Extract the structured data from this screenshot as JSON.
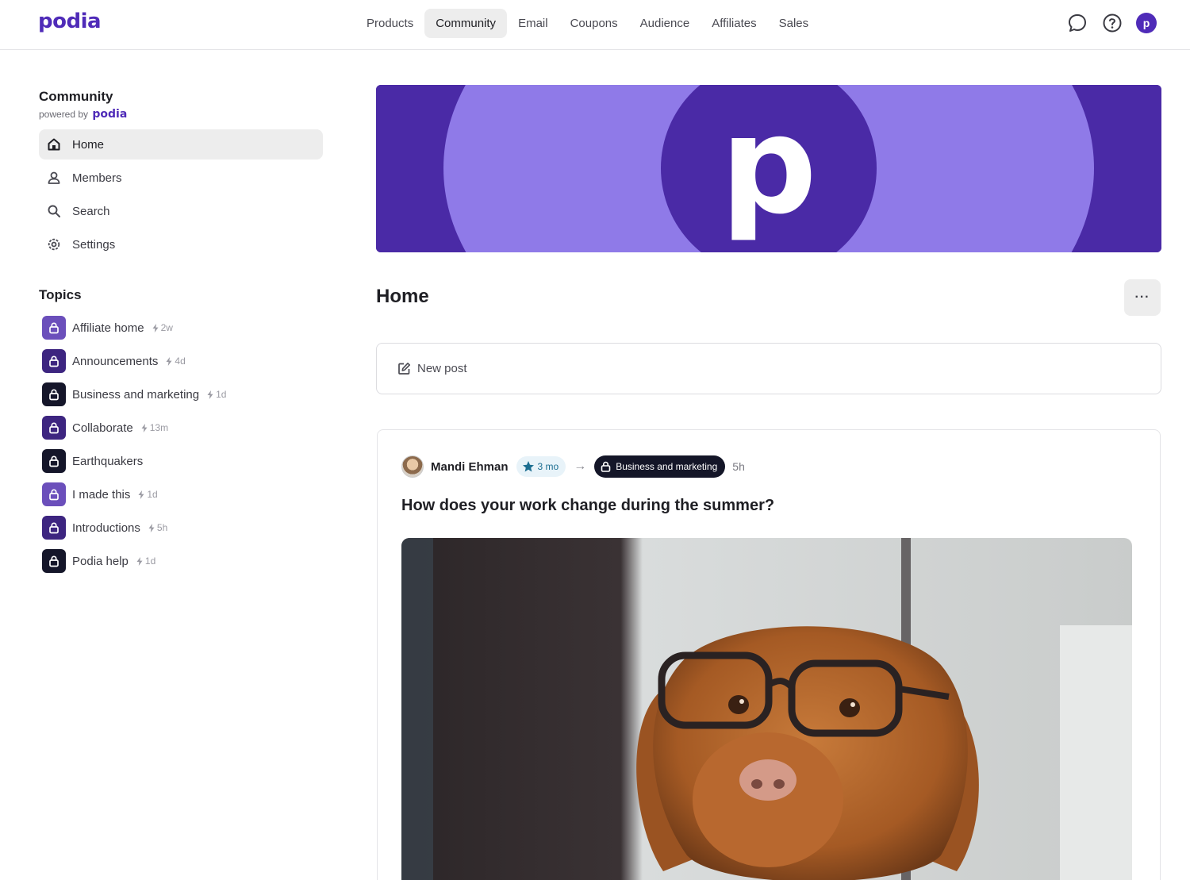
{
  "app": {
    "logo": "podia"
  },
  "nav": {
    "items": [
      "Products",
      "Community",
      "Email",
      "Coupons",
      "Audience",
      "Affiliates",
      "Sales"
    ],
    "active": "Community"
  },
  "header_icons": {
    "chat": "chat-icon",
    "help": "help-icon",
    "account_initial": "p"
  },
  "sidebar": {
    "title": "Community",
    "powered_by": "powered by",
    "powered_brand": "podia",
    "menu": [
      {
        "label": "Home",
        "icon": "home-icon",
        "active": true
      },
      {
        "label": "Members",
        "icon": "person-icon"
      },
      {
        "label": "Search",
        "icon": "search-icon"
      },
      {
        "label": "Settings",
        "icon": "gear-icon"
      }
    ],
    "topics_title": "Topics",
    "topics": [
      {
        "label": "Affiliate home",
        "activity": "2w",
        "color": "#6b4fbb"
      },
      {
        "label": "Announcements",
        "activity": "4d",
        "color": "#3d2580"
      },
      {
        "label": "Business and marketing",
        "activity": "1d",
        "color": "#15162a"
      },
      {
        "label": "Collaborate",
        "activity": "13m",
        "color": "#3d2580"
      },
      {
        "label": "Earthquakers",
        "activity": "",
        "color": "#15162a"
      },
      {
        "label": "I made this",
        "activity": "1d",
        "color": "#6b4fbb"
      },
      {
        "label": "Introductions",
        "activity": "5h",
        "color": "#3d2580"
      },
      {
        "label": "Podia help",
        "activity": "1d",
        "color": "#15162a"
      }
    ]
  },
  "main": {
    "banner_letter": "p",
    "title": "Home",
    "more_label": "···",
    "new_post_label": "New post",
    "post": {
      "author": "Mandi Ehman",
      "tenure": "3 mo",
      "topic": "Business and marketing",
      "time": "5h",
      "title": "How does your work change during the summer?"
    }
  },
  "colors": {
    "brand": "#4f2bb8",
    "banner_light": "#8f7ae8",
    "banner_dark": "#4a2aa6"
  }
}
